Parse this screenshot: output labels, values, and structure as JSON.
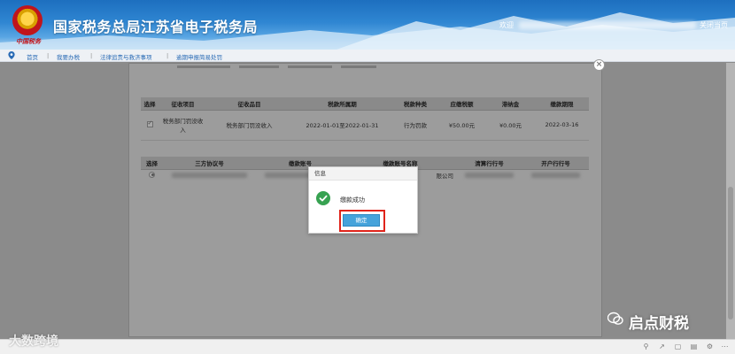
{
  "header": {
    "site_title": "国家税务总局江苏省电子税务局",
    "emblem_script": "中国税务",
    "welcome": "欢迎",
    "close_page": "关闭当页"
  },
  "breadcrumb": [
    "首页",
    "我要办税",
    "法律追责与救济事项",
    "逾期申报简易处罚"
  ],
  "levy_table": {
    "headers": [
      "选择",
      "征收项目",
      "征收品目",
      "税款所属期",
      "税款种类",
      "应缴税额",
      "滞纳金",
      "缴款期限"
    ],
    "row": {
      "item": "税务部门罚没收入",
      "category": "税务部门罚没收入",
      "period": "2022-01-01至2022-01-31",
      "type": "行为罚款",
      "amount": "¥50.00元",
      "late_fee": "¥0.00元",
      "deadline": "2022-03-16"
    }
  },
  "bank_table": {
    "headers": [
      "选择",
      "三方协议号",
      "缴款账号",
      "缴款账号名称",
      "清算行行号",
      "开户行行号"
    ],
    "row": {
      "account_name_suffix": "限公司"
    }
  },
  "popup": {
    "title": "信息",
    "message": "缴款成功",
    "ok_label": "确定"
  },
  "watermarks": {
    "left": "大数跨境",
    "right": "启点财税"
  },
  "colors": {
    "header_blue": "#1d6fbf",
    "success_green": "#37a251",
    "button_blue": "#45a3db",
    "highlight_red": "#e0241b"
  }
}
